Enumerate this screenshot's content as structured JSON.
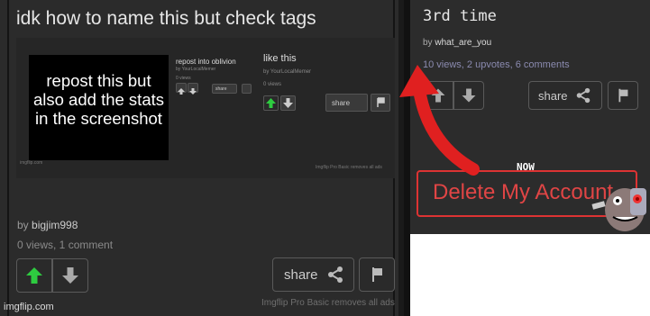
{
  "left_post": {
    "title": "idk how to name this but check tags",
    "byline_prefix": "by ",
    "author": "bigjim998",
    "stats": "0 views, 1 comment",
    "share_label": "share",
    "pro_note": "Imgflip Pro Basic removes all ads",
    "watermark": "imgflip.com"
  },
  "screenshot": {
    "caption": "repost this but also add the stats in the screenshot",
    "repost_title": "repost into oblivion",
    "repost_by": "by YourLocalMemer",
    "repost_views": "0 views",
    "like_title": "like this",
    "like_by": "by YourLocalMemer",
    "like_views": "0 views",
    "share_label": "share",
    "watermark": "imgflip.com",
    "pro_note": "Imgflip Pro Basic removes all ads"
  },
  "right_post": {
    "title": "3rd time",
    "byline_prefix": "by ",
    "author": "what_are_you",
    "stats": "10 views, 2 upvotes, 6 comments",
    "share_label": "share",
    "now_label": "NOW",
    "delete_label": "Delete My Account"
  },
  "colors": {
    "upvote_active": "#2ecc40",
    "arrow_red": "#e02020",
    "delete_red": "#e04545"
  },
  "icons": [
    "up-arrow-icon",
    "down-arrow-icon",
    "share-icon",
    "flag-icon",
    "curved-arrow-icon",
    "cartoon-face-icon"
  ]
}
